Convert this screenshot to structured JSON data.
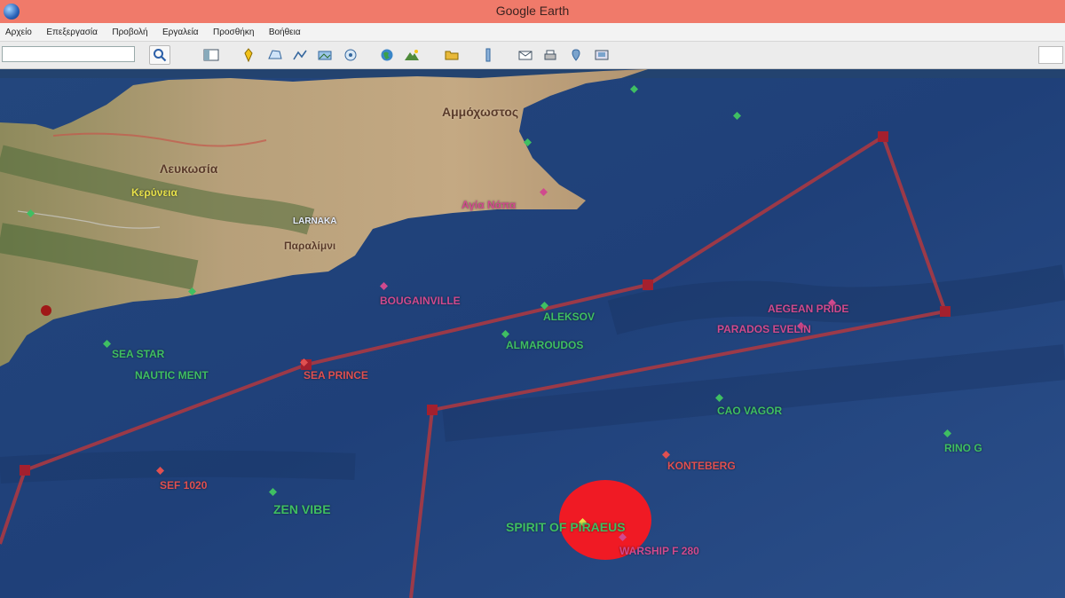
{
  "window": {
    "title": "Google Earth"
  },
  "menu": {
    "items": [
      "Αρχείο",
      "Επεξεργασία",
      "Προβολή",
      "Εργαλεία",
      "Προσθήκη",
      "Βοήθεια"
    ]
  },
  "toolbar": {
    "search_value": "",
    "search_placeholder": "",
    "buttons": [
      "sidebar-icon",
      "placemark-icon",
      "polygon-icon",
      "path-icon",
      "image-overlay-icon",
      "tour-icon",
      "sun-icon",
      "sky-icon",
      "ruler-icon",
      "email-icon",
      "print-icon",
      "maps-icon",
      "save-image-icon"
    ]
  },
  "colors": {
    "titlebar": "#f07a6a",
    "route": "#b2383f",
    "zone": "#f01a24",
    "ship_green": "#3fbf62",
    "ship_red": "#e05050",
    "ship_pink": "#d04a8e"
  },
  "map": {
    "places": {
      "ammochostos": "Αμμόχωστος",
      "lefkosia": "Λευκωσία",
      "kyrenia": "Κερύνεια",
      "larnaka": "LARNAKA",
      "ayia_napa": "Αγία Νάπα",
      "paralimni": "Παραλίμνι"
    },
    "ships": {
      "s1": "SPIRIT OF PIRAEUS",
      "s2": "WARSHIP F 280",
      "s3": "ZEN VIBE",
      "s4": "SEF 1020",
      "s5": "KONTEBERG",
      "s6": "CAO VAGOR",
      "s7": "RINO G",
      "s8": "ALEKSOV",
      "s9": "ALMAROUDOS",
      "s10": "PARADOS EVELIN",
      "s11": "SEA PRINCE",
      "s12": "AEGEAN PRIDE",
      "s13": "NAUTIC MENT",
      "s14": "BOUGAINVILLE",
      "s15": "SEA STAR"
    }
  }
}
